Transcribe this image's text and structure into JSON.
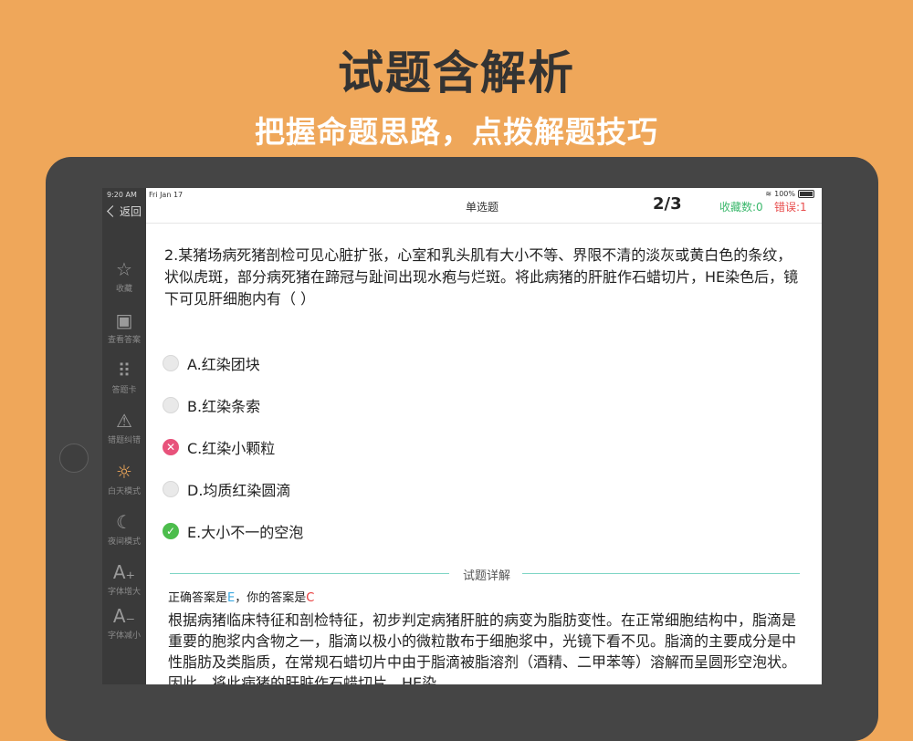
{
  "banner": {
    "title": "试题含解析",
    "subtitle": "把握命题思路，点拨解题技巧"
  },
  "status": {
    "time": "9:20 AM",
    "date": "Fri Jan 17",
    "battery": "100%"
  },
  "sidebar": {
    "back_label": "返回",
    "items": [
      {
        "label": "收藏",
        "icon": "☆"
      },
      {
        "label": "查看答案",
        "icon": "▣"
      },
      {
        "label": "答题卡",
        "icon": "⠿"
      },
      {
        "label": "错题纠错",
        "icon": "⚠"
      },
      {
        "label": "白天模式",
        "icon": "☼"
      },
      {
        "label": "夜间模式",
        "icon": "☾"
      },
      {
        "label": "字体增大",
        "icon": "A₊"
      },
      {
        "label": "字体减小",
        "icon": "A₋"
      }
    ]
  },
  "header": {
    "type": "单选题",
    "progress": "2/3",
    "favorites": "收藏数:0",
    "errors": "错误:1"
  },
  "question": {
    "text": "2.某猪场病死猪剖检可见心脏扩张，心室和乳头肌有大小不等、界限不清的淡灰或黄白色的条纹，状似虎斑，部分病死猪在蹄冠与趾间出现水疱与烂斑。将此病猪的肝脏作石蜡切片，HE染色后，镜下可见肝细胞内有（ ）",
    "options": [
      {
        "text": "A.红染团块",
        "state": "none"
      },
      {
        "text": "B.红染条索",
        "state": "none"
      },
      {
        "text": "C.红染小颗粒",
        "state": "wrong"
      },
      {
        "text": "D.均质红染圆滴",
        "state": "none"
      },
      {
        "text": "E.大小不一的空泡",
        "state": "right"
      }
    ]
  },
  "analysis": {
    "section_title": "试题详解",
    "correct_prefix": "正确答案是",
    "correct_answer": "E",
    "your_prefix": "，你的答案是",
    "your_answer": "C",
    "text": "根据病猪临床特征和剖检特征，初步判定病猪肝脏的病变为脂肪变性。在正常细胞结构中，脂滴是重要的胞浆内含物之一，脂滴以极小的微粒散布于细胞浆中，光镜下看不见。脂滴的主要成分是中性脂肪及类脂质，在常规石蜡切片中由于脂滴被脂溶剂（酒精、二甲苯等）溶解而呈圆形空泡状。因此，将此病猪的肝脏作石蜡切片，HE染"
  },
  "colors": {
    "background": "#EFA75A",
    "favorites": "#3bb86c",
    "errors": "#e84d4d",
    "wrong_option": "#e8527b",
    "right_option": "#4cbd4c"
  }
}
